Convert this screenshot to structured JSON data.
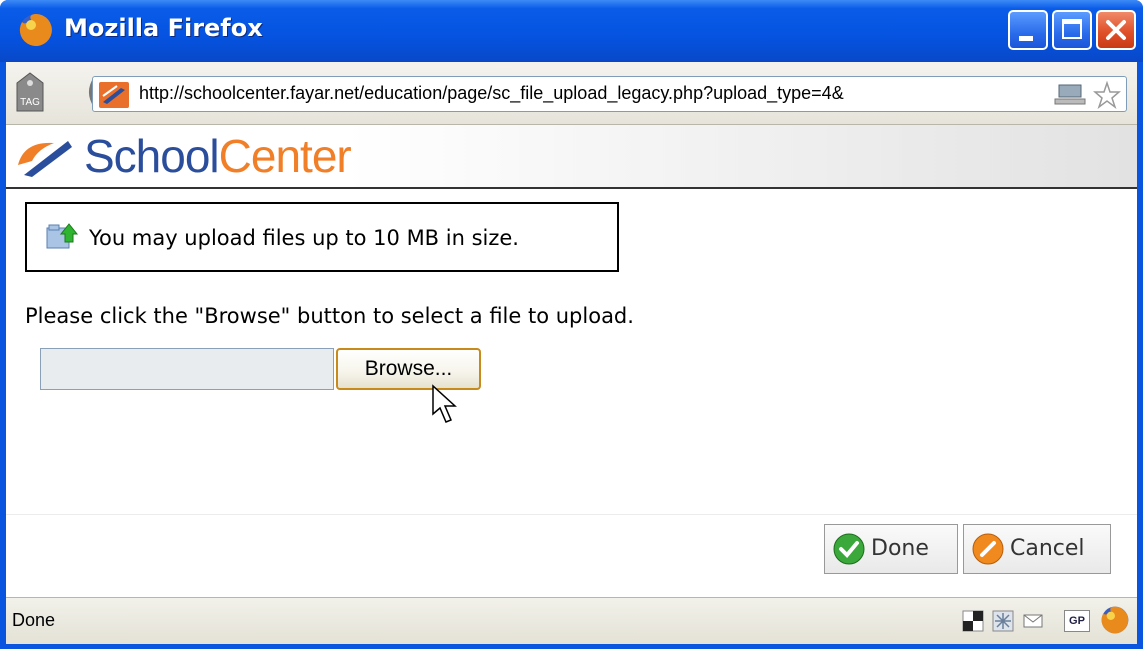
{
  "window": {
    "title": "Mozilla Firefox"
  },
  "urlbar": {
    "url": "http://schoolcenter.fayar.net/education/page/sc_file_upload_legacy.php?upload_type=4&",
    "tag_label": "TAG"
  },
  "brand": {
    "part1": "School",
    "part2": "Center"
  },
  "content": {
    "info_text": "You may upload files up to 10 MB in size.",
    "instructions": "Please click the \"Browse\" button to select a file to upload.",
    "browse_label": "Browse..."
  },
  "footer": {
    "done_label": "Done",
    "cancel_label": "Cancel"
  },
  "statusbar": {
    "status": "Done",
    "gp_label": "GP"
  },
  "colors": {
    "titlebar": "#0553e0",
    "brand_blue": "#2b4e9c",
    "brand_orange": "#f07f28",
    "browse_border": "#c98a1c"
  }
}
